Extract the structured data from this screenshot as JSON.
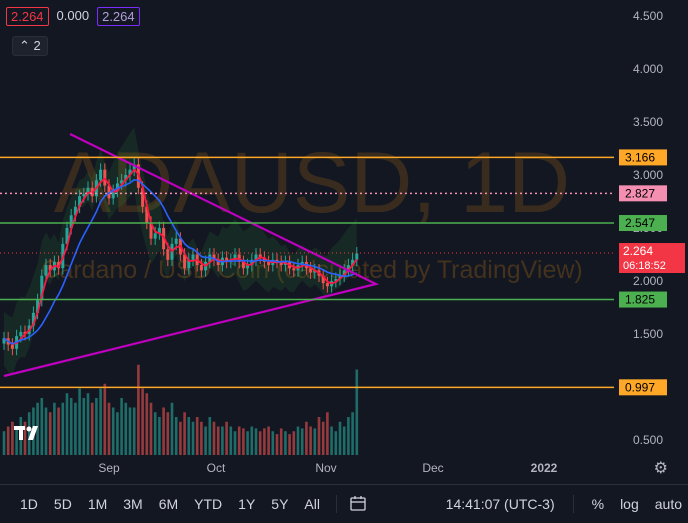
{
  "legend": {
    "open": "2.264",
    "mid": "0.000",
    "close": "2.264"
  },
  "collapse_label": "2",
  "watermark": {
    "symbol": "ADAUSD, 1D",
    "subtitle": "Cardano / USD Coin (calculated by TradingView)"
  },
  "toolbar": {
    "timeframes": [
      "1D",
      "5D",
      "1M",
      "3M",
      "6M",
      "YTD",
      "1Y",
      "5Y",
      "All"
    ],
    "clock": "14:41:07 (UTC-3)",
    "percent": "%",
    "log": "log",
    "auto": "auto"
  },
  "colors": {
    "background": "#131722",
    "up": "#26a69a",
    "down": "#ef5350",
    "orange_level": "#ffa726",
    "green_level": "#4caf50",
    "pink_level": "#f48fb1",
    "triangle": "#c000c0",
    "red_line": "#ff1744",
    "blue_line": "#2962ff"
  },
  "icons": {
    "gear": "gear-icon",
    "calendar": "calendar-range-icon",
    "logo": "tradingview-logo-icon"
  },
  "chart_data": {
    "type": "candlestick",
    "symbol": "ADAUSD",
    "interval": "1D",
    "y_axis": {
      "ticks": [
        4.5,
        4.0,
        3.5,
        3.0,
        2.5,
        2.0,
        1.5,
        1.0,
        0.5
      ],
      "tick_labels": [
        "4.500",
        "4.000",
        "3.500",
        "3.000",
        "2.500",
        "2.000",
        "1.500",
        "1.000",
        "0.500"
      ],
      "range": [
        0.33,
        4.62
      ]
    },
    "x_axis": {
      "tick_labels": [
        "Sep",
        "Oct",
        "Nov",
        "Dec",
        "2022"
      ],
      "bold_label": "2022"
    },
    "price_levels": [
      {
        "value": 3.166,
        "label": "3.166",
        "color": "#ffa726",
        "style": "solid"
      },
      {
        "value": 2.827,
        "label": "2.827",
        "color": "#f48fb1",
        "style": "dotted"
      },
      {
        "value": 2.547,
        "label": "2.547",
        "color": "#4caf50",
        "style": "solid"
      },
      {
        "value": 1.825,
        "label": "1.825",
        "color": "#4caf50",
        "style": "solid"
      },
      {
        "value": 0.997,
        "label": "0.997",
        "color": "#ffa726",
        "style": "solid"
      }
    ],
    "last_price": {
      "value": 2.264,
      "label": "2.264",
      "countdown": "06:18:52",
      "color": "#f23645"
    },
    "close_series": [
      1.46,
      1.4,
      1.36,
      1.48,
      1.52,
      1.5,
      1.58,
      1.7,
      1.82,
      2.05,
      2.15,
      2.1,
      2.18,
      2.12,
      2.35,
      2.5,
      2.62,
      2.7,
      2.8,
      2.82,
      2.88,
      2.8,
      2.95,
      3.05,
      2.9,
      2.78,
      2.85,
      2.92,
      2.95,
      3.0,
      3.05,
      3.1,
      2.88,
      2.7,
      2.55,
      2.4,
      2.45,
      2.5,
      2.3,
      2.2,
      2.35,
      2.4,
      2.25,
      2.12,
      2.2,
      2.25,
      2.15,
      2.1,
      2.18,
      2.25,
      2.2,
      2.15,
      2.22,
      2.18,
      2.2,
      2.25,
      2.18,
      2.12,
      2.15,
      2.2,
      2.25,
      2.22,
      2.18,
      2.15,
      2.2,
      2.18,
      2.15,
      2.18,
      2.12,
      2.1,
      2.15,
      2.18,
      2.12,
      2.08,
      2.1,
      2.05,
      1.98,
      1.95,
      2.0,
      2.02,
      2.05,
      2.1,
      2.15,
      2.2,
      2.26
    ],
    "volume_series": [
      0.25,
      0.3,
      0.35,
      0.3,
      0.4,
      0.35,
      0.45,
      0.5,
      0.55,
      0.6,
      0.5,
      0.45,
      0.55,
      0.5,
      0.55,
      0.65,
      0.6,
      0.55,
      0.7,
      0.6,
      0.65,
      0.55,
      0.6,
      0.7,
      0.75,
      0.55,
      0.5,
      0.45,
      0.6,
      0.55,
      0.5,
      0.5,
      0.95,
      0.7,
      0.65,
      0.55,
      0.45,
      0.4,
      0.5,
      0.45,
      0.55,
      0.4,
      0.35,
      0.45,
      0.4,
      0.35,
      0.4,
      0.35,
      0.3,
      0.4,
      0.35,
      0.3,
      0.3,
      0.35,
      0.3,
      0.25,
      0.3,
      0.28,
      0.25,
      0.3,
      0.28,
      0.25,
      0.28,
      0.3,
      0.25,
      0.22,
      0.28,
      0.25,
      0.22,
      0.25,
      0.3,
      0.28,
      0.35,
      0.3,
      0.28,
      0.4,
      0.35,
      0.45,
      0.3,
      0.25,
      0.35,
      0.3,
      0.4,
      0.45,
      0.9
    ]
  }
}
